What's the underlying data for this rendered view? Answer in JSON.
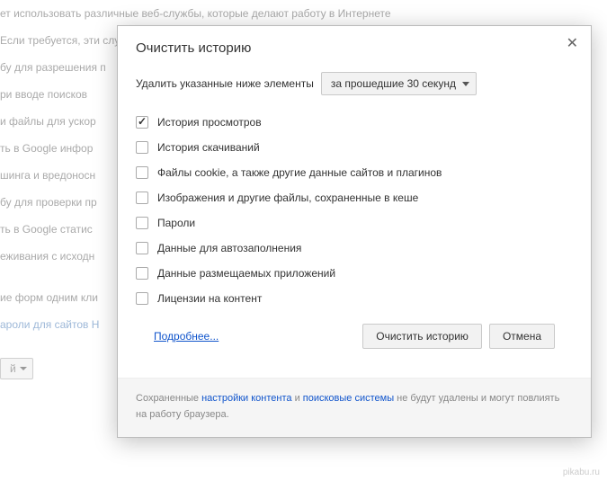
{
  "background": {
    "lines": [
      "ет использовать различные веб-службы, которые делают работу в Интернете",
      "Если требуется, эти службы можно отключить. Подробнее...",
      "бу для разрешения п",
      "ри вводе поисков",
      "и файлы для ускор",
      "ть в Google инфор",
      "шинга и вредоносн",
      "бу для проверки пр",
      "ть в Google статис",
      "еживания с исходн",
      "ие форм одним кли",
      "ароли для сайтов Н"
    ],
    "dropdown": "й"
  },
  "dialog": {
    "title": "Очистить историю",
    "range_label": "Удалить указанные ниже элементы",
    "range_value": "за прошедшие 30 секунд",
    "items": [
      {
        "label": "История просмотров",
        "checked": true
      },
      {
        "label": "История скачиваний",
        "checked": false
      },
      {
        "label": "Файлы cookie, а также другие данные сайтов и плагинов",
        "checked": false
      },
      {
        "label": "Изображения и другие файлы, сохраненные в кеше",
        "checked": false
      },
      {
        "label": "Пароли",
        "checked": false
      },
      {
        "label": "Данные для автозаполнения",
        "checked": false
      },
      {
        "label": "Данные размещаемых приложений",
        "checked": false
      },
      {
        "label": "Лицензии на контент",
        "checked": false
      }
    ],
    "learn_more": "Подробнее...",
    "btn_clear": "Очистить историю",
    "btn_cancel": "Отмена",
    "footer_prefix": "Сохраненные ",
    "footer_link1": "настройки контента",
    "footer_mid": " и ",
    "footer_link2": "поисковые системы",
    "footer_suffix": " не будут удалены и могут повлиять на работу браузера."
  },
  "watermark": "pikabu.ru"
}
